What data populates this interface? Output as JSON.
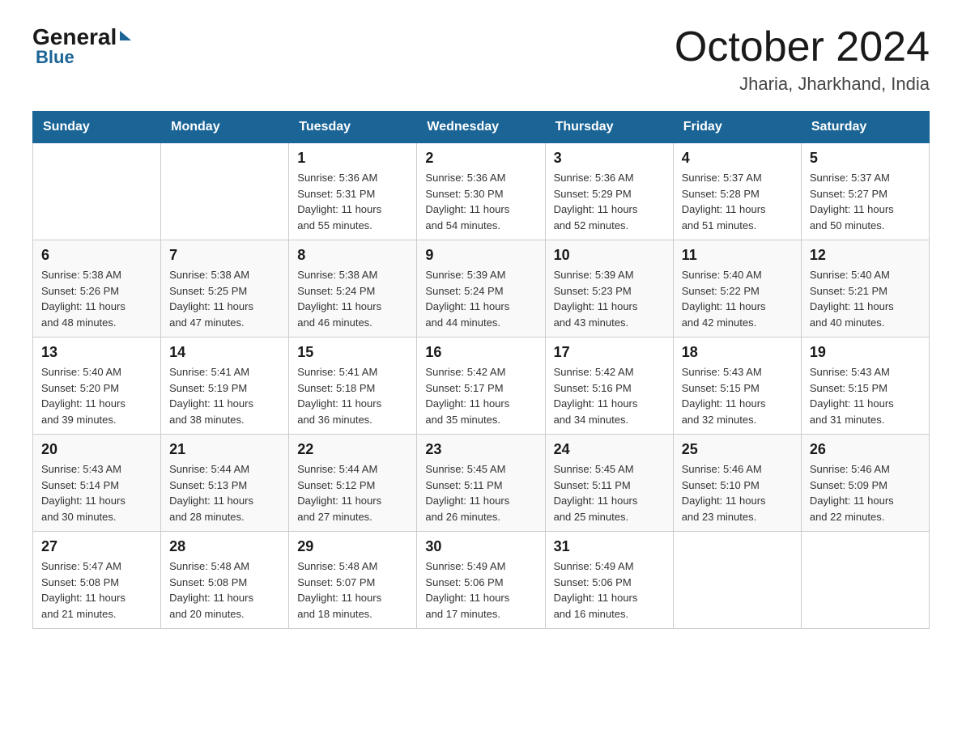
{
  "header": {
    "logo_general": "General",
    "logo_blue": "Blue",
    "month_title": "October 2024",
    "location": "Jharia, Jharkhand, India"
  },
  "days_of_week": [
    "Sunday",
    "Monday",
    "Tuesday",
    "Wednesday",
    "Thursday",
    "Friday",
    "Saturday"
  ],
  "weeks": [
    [
      {
        "day": "",
        "info": ""
      },
      {
        "day": "",
        "info": ""
      },
      {
        "day": "1",
        "info": "Sunrise: 5:36 AM\nSunset: 5:31 PM\nDaylight: 11 hours\nand 55 minutes."
      },
      {
        "day": "2",
        "info": "Sunrise: 5:36 AM\nSunset: 5:30 PM\nDaylight: 11 hours\nand 54 minutes."
      },
      {
        "day": "3",
        "info": "Sunrise: 5:36 AM\nSunset: 5:29 PM\nDaylight: 11 hours\nand 52 minutes."
      },
      {
        "day": "4",
        "info": "Sunrise: 5:37 AM\nSunset: 5:28 PM\nDaylight: 11 hours\nand 51 minutes."
      },
      {
        "day": "5",
        "info": "Sunrise: 5:37 AM\nSunset: 5:27 PM\nDaylight: 11 hours\nand 50 minutes."
      }
    ],
    [
      {
        "day": "6",
        "info": "Sunrise: 5:38 AM\nSunset: 5:26 PM\nDaylight: 11 hours\nand 48 minutes."
      },
      {
        "day": "7",
        "info": "Sunrise: 5:38 AM\nSunset: 5:25 PM\nDaylight: 11 hours\nand 47 minutes."
      },
      {
        "day": "8",
        "info": "Sunrise: 5:38 AM\nSunset: 5:24 PM\nDaylight: 11 hours\nand 46 minutes."
      },
      {
        "day": "9",
        "info": "Sunrise: 5:39 AM\nSunset: 5:24 PM\nDaylight: 11 hours\nand 44 minutes."
      },
      {
        "day": "10",
        "info": "Sunrise: 5:39 AM\nSunset: 5:23 PM\nDaylight: 11 hours\nand 43 minutes."
      },
      {
        "day": "11",
        "info": "Sunrise: 5:40 AM\nSunset: 5:22 PM\nDaylight: 11 hours\nand 42 minutes."
      },
      {
        "day": "12",
        "info": "Sunrise: 5:40 AM\nSunset: 5:21 PM\nDaylight: 11 hours\nand 40 minutes."
      }
    ],
    [
      {
        "day": "13",
        "info": "Sunrise: 5:40 AM\nSunset: 5:20 PM\nDaylight: 11 hours\nand 39 minutes."
      },
      {
        "day": "14",
        "info": "Sunrise: 5:41 AM\nSunset: 5:19 PM\nDaylight: 11 hours\nand 38 minutes."
      },
      {
        "day": "15",
        "info": "Sunrise: 5:41 AM\nSunset: 5:18 PM\nDaylight: 11 hours\nand 36 minutes."
      },
      {
        "day": "16",
        "info": "Sunrise: 5:42 AM\nSunset: 5:17 PM\nDaylight: 11 hours\nand 35 minutes."
      },
      {
        "day": "17",
        "info": "Sunrise: 5:42 AM\nSunset: 5:16 PM\nDaylight: 11 hours\nand 34 minutes."
      },
      {
        "day": "18",
        "info": "Sunrise: 5:43 AM\nSunset: 5:15 PM\nDaylight: 11 hours\nand 32 minutes."
      },
      {
        "day": "19",
        "info": "Sunrise: 5:43 AM\nSunset: 5:15 PM\nDaylight: 11 hours\nand 31 minutes."
      }
    ],
    [
      {
        "day": "20",
        "info": "Sunrise: 5:43 AM\nSunset: 5:14 PM\nDaylight: 11 hours\nand 30 minutes."
      },
      {
        "day": "21",
        "info": "Sunrise: 5:44 AM\nSunset: 5:13 PM\nDaylight: 11 hours\nand 28 minutes."
      },
      {
        "day": "22",
        "info": "Sunrise: 5:44 AM\nSunset: 5:12 PM\nDaylight: 11 hours\nand 27 minutes."
      },
      {
        "day": "23",
        "info": "Sunrise: 5:45 AM\nSunset: 5:11 PM\nDaylight: 11 hours\nand 26 minutes."
      },
      {
        "day": "24",
        "info": "Sunrise: 5:45 AM\nSunset: 5:11 PM\nDaylight: 11 hours\nand 25 minutes."
      },
      {
        "day": "25",
        "info": "Sunrise: 5:46 AM\nSunset: 5:10 PM\nDaylight: 11 hours\nand 23 minutes."
      },
      {
        "day": "26",
        "info": "Sunrise: 5:46 AM\nSunset: 5:09 PM\nDaylight: 11 hours\nand 22 minutes."
      }
    ],
    [
      {
        "day": "27",
        "info": "Sunrise: 5:47 AM\nSunset: 5:08 PM\nDaylight: 11 hours\nand 21 minutes."
      },
      {
        "day": "28",
        "info": "Sunrise: 5:48 AM\nSunset: 5:08 PM\nDaylight: 11 hours\nand 20 minutes."
      },
      {
        "day": "29",
        "info": "Sunrise: 5:48 AM\nSunset: 5:07 PM\nDaylight: 11 hours\nand 18 minutes."
      },
      {
        "day": "30",
        "info": "Sunrise: 5:49 AM\nSunset: 5:06 PM\nDaylight: 11 hours\nand 17 minutes."
      },
      {
        "day": "31",
        "info": "Sunrise: 5:49 AM\nSunset: 5:06 PM\nDaylight: 11 hours\nand 16 minutes."
      },
      {
        "day": "",
        "info": ""
      },
      {
        "day": "",
        "info": ""
      }
    ]
  ]
}
